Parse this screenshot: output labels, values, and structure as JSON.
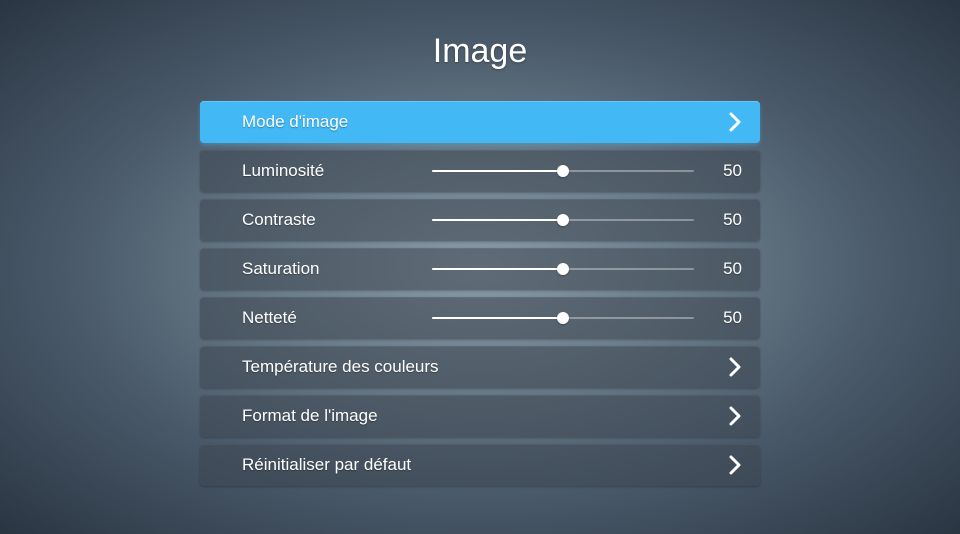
{
  "title": "Image",
  "accent_color": "#42b8f5",
  "items": [
    {
      "kind": "nav",
      "label": "Mode d'image",
      "selected": true
    },
    {
      "kind": "slider",
      "label": "Luminosité",
      "value": 50,
      "max": 100
    },
    {
      "kind": "slider",
      "label": "Contraste",
      "value": 50,
      "max": 100
    },
    {
      "kind": "slider",
      "label": "Saturation",
      "value": 50,
      "max": 100
    },
    {
      "kind": "slider",
      "label": "Netteté",
      "value": 50,
      "max": 100
    },
    {
      "kind": "nav",
      "label": "Température des couleurs",
      "selected": false
    },
    {
      "kind": "nav",
      "label": "Format de l'image",
      "selected": false
    },
    {
      "kind": "nav",
      "label": "Réinitialiser par défaut",
      "selected": false
    }
  ]
}
